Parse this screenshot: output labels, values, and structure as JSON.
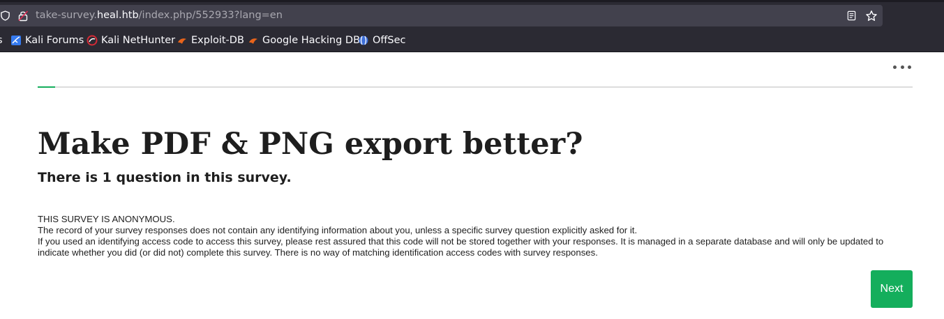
{
  "browser": {
    "url_prefix": "take-survey.",
    "url_host": "heal.htb",
    "url_path": "/index.php/552933?lang=en",
    "bookmarks": [
      {
        "label": "s",
        "icon": "bookmark-fragment"
      },
      {
        "label": "Kali Forums",
        "icon": "kali-forums-icon"
      },
      {
        "label": "Kali NetHunter",
        "icon": "kali-nethunter-icon"
      },
      {
        "label": "Exploit-DB",
        "icon": "exploit-db-icon"
      },
      {
        "label": "Google Hacking DB",
        "icon": "google-hacking-db-icon"
      },
      {
        "label": "OffSec",
        "icon": "offsec-icon"
      }
    ]
  },
  "survey": {
    "title": "Make PDF & PNG export better?",
    "question_count": "There is 1 question in this survey.",
    "progress_fraction": 0.02,
    "privacy_heading": "THIS SURVEY IS ANONYMOUS.",
    "privacy_line1": "The record of your survey responses does not contain any identifying information about you, unless a specific survey question explicitly asked for it.",
    "privacy_line2": "If you used an identifying access code to access this survey, please rest assured that this code will not be stored together with your responses. It is managed in a separate database and will only be updated to indicate whether you did (or did not) complete this survey. There is no way of matching identification access codes with survey responses.",
    "next_label": "Next"
  },
  "colors": {
    "accent": "#14ae5c",
    "text": "#1e1e1e",
    "chrome": "#2b2a33",
    "url_bar": "#42414d"
  }
}
